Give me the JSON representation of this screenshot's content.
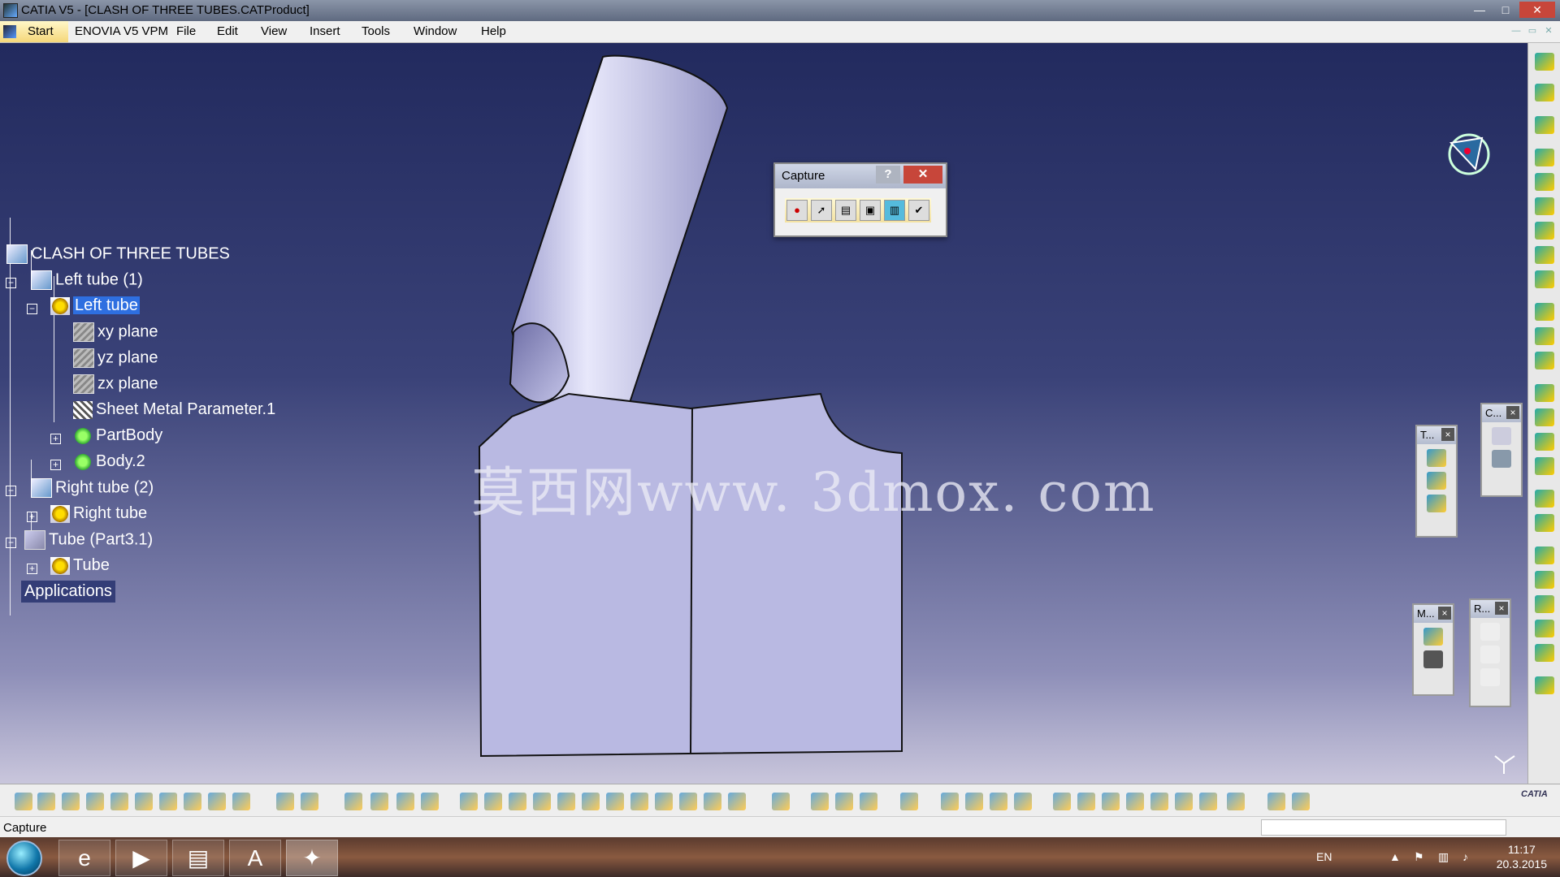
{
  "window": {
    "title": "CATIA V5 - [CLASH OF THREE TUBES.CATProduct]",
    "min": "—",
    "max": "□",
    "close": "✕"
  },
  "menu": {
    "start": "Start",
    "items": [
      "ENOVIA V5 VPM",
      "File",
      "Edit",
      "View",
      "Insert",
      "Tools",
      "Window",
      "Help"
    ]
  },
  "tree": {
    "root": "CLASH OF THREE TUBES",
    "left_tube_inst": "Left tube (1)",
    "left_tube_part": "Left tube",
    "xy": "xy plane",
    "yz": "yz plane",
    "zx": "zx plane",
    "sheet_metal": "Sheet Metal Parameter.1",
    "partbody": "PartBody",
    "body2": "Body.2",
    "right_tube_inst": "Right tube (2)",
    "right_tube_part": "Right tube",
    "tube_inst": "Tube (Part3.1)",
    "tube_part": "Tube",
    "applications": "Applications"
  },
  "watermark": "莫西网www. 3dmox. com",
  "capture": {
    "title": "Capture",
    "help": "?",
    "close": "✕",
    "tools": [
      "record-icon",
      "select-icon",
      "options-icon",
      "capture-icon",
      "image-icon",
      "album-icon"
    ]
  },
  "float_toolbars": {
    "t": "T...",
    "c": "C...",
    "m": "M...",
    "r": "R...",
    "close": "×"
  },
  "status": {
    "text": "Capture"
  },
  "taskbar": {
    "lang": "EN",
    "time": "11:17",
    "date": "20.3.2015"
  },
  "colors": {
    "viewport_top": "#222a5e",
    "viewport_bottom": "#c9c6dc",
    "selection": "#2e6fe0",
    "tube_face": "#b8b8e0"
  }
}
